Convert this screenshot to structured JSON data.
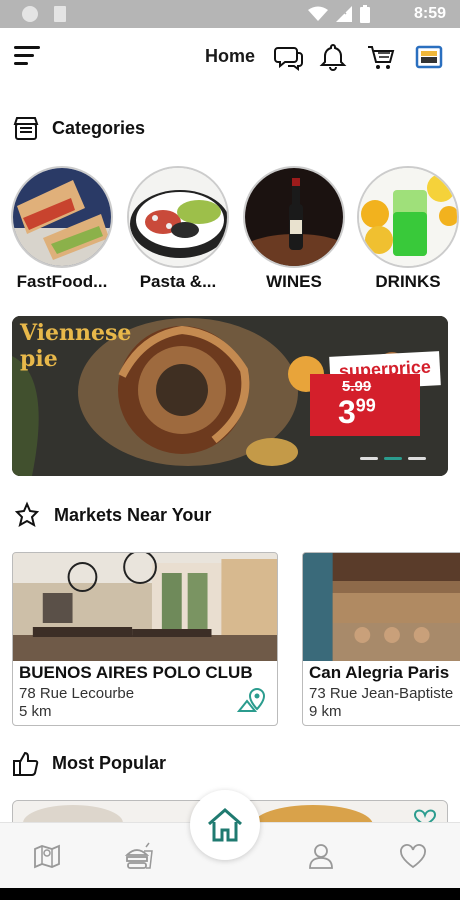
{
  "status_bar": {
    "time": "8:59"
  },
  "header": {
    "title": "Home"
  },
  "categories": {
    "title": "Categories",
    "items": [
      {
        "label": "FastFood..."
      },
      {
        "label": "Pasta &..."
      },
      {
        "label": "WINES"
      },
      {
        "label": "DRINKS"
      }
    ]
  },
  "banner": {
    "title": "Viennese pie",
    "tag": "superprice",
    "old_price": "5.99",
    "price_main": "3",
    "price_cents": "99"
  },
  "markets": {
    "title": "Markets Near Your",
    "items": [
      {
        "name": "BUENOS AIRES POLO CLUB",
        "address": "78 Rue Lecourbe",
        "distance": "5 km"
      },
      {
        "name": "Can Alegria Paris",
        "address": "73 Rue Jean-Baptiste",
        "distance": "9 km"
      }
    ]
  },
  "popular": {
    "title": "Most Popular"
  },
  "colors": {
    "accent": "#2b9c8e",
    "price_red": "#d41f2b"
  }
}
